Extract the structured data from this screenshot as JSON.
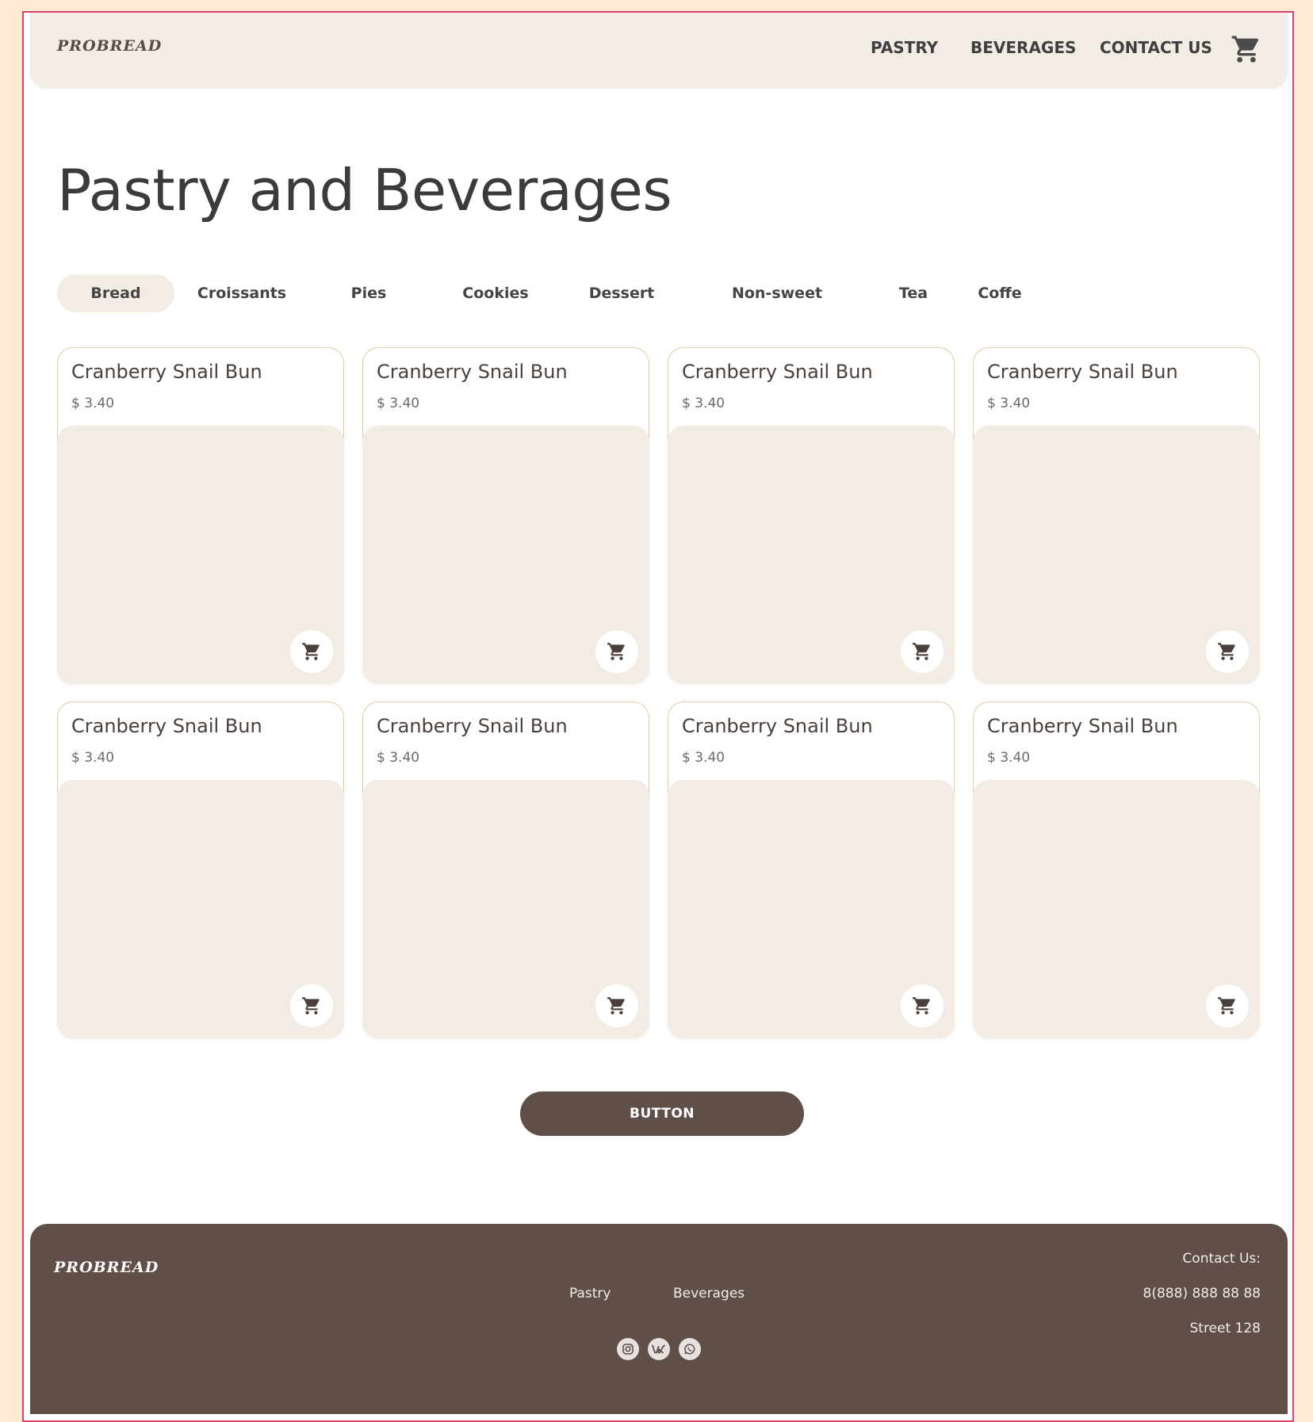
{
  "header": {
    "logo": "PROBREAD",
    "nav": [
      "PASTRY",
      "BEVERAGES",
      "CONTACT US"
    ]
  },
  "page_title": "Pastry and Beverages",
  "tabs": [
    "Bread",
    "Croissants",
    "Pies",
    "Cookies",
    "Dessert",
    "Non-sweet",
    "Tea",
    "Coffe"
  ],
  "active_tab": "Bread",
  "products": [
    {
      "name": "Cranberry Snail Bun",
      "price": "$ 3.40"
    },
    {
      "name": "Cranberry Snail Bun",
      "price": "$ 3.40"
    },
    {
      "name": "Cranberry Snail Bun",
      "price": "$ 3.40"
    },
    {
      "name": "Cranberry Snail Bun",
      "price": "$ 3.40"
    },
    {
      "name": "Cranberry Snail Bun",
      "price": "$ 3.40"
    },
    {
      "name": "Cranberry Snail Bun",
      "price": "$ 3.40"
    },
    {
      "name": "Cranberry Snail Bun",
      "price": "$ 3.40"
    },
    {
      "name": "Cranberry Snail Bun",
      "price": "$ 3.40"
    }
  ],
  "button_label": "BUTTON",
  "footer": {
    "logo": "PROBREAD",
    "links": [
      "Pastry",
      "Beverages"
    ],
    "contact_title": "Contact Us:",
    "phone": "8(888) 888 88 88",
    "address": "Street 128",
    "socials": [
      "instagram-icon",
      "vk-icon",
      "whatsapp-icon"
    ]
  },
  "colors": {
    "background": "#fde9d4",
    "panel": "#f3ece4",
    "brown": "#604f48",
    "frame_border": "#e0416b",
    "card_border": "#e6c9a6"
  }
}
